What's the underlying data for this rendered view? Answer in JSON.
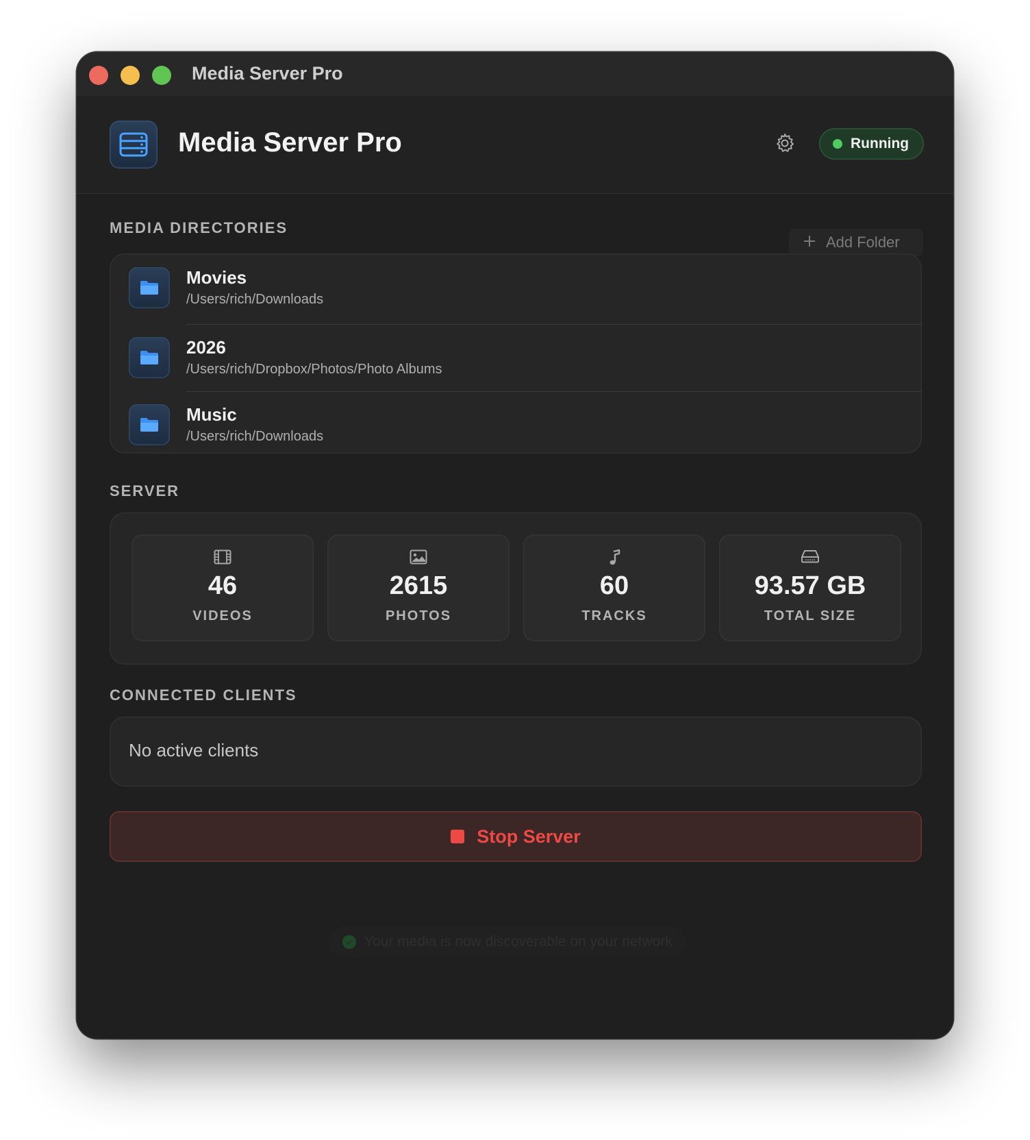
{
  "window": {
    "title": "Media Server Pro"
  },
  "header": {
    "app_name": "Media Server Pro",
    "app_icon": "server-rack-icon",
    "settings_icon": "gear-icon",
    "status": "Running",
    "status_color": "#4fcb62"
  },
  "directories": {
    "label": "MEDIA DIRECTORIES",
    "add_button": "Add Folder",
    "items": [
      {
        "name": "Movies",
        "path": "/Users/rich/Downloads",
        "icon": "folder-icon"
      },
      {
        "name": "2026",
        "path": "/Users/rich/Dropbox/Photos/Photo Albums",
        "icon": "folder-icon"
      },
      {
        "name": "Music",
        "path": "/Users/rich/Downloads",
        "icon": "folder-icon"
      }
    ]
  },
  "server": {
    "label": "SERVER",
    "stats": [
      {
        "value": "46",
        "label": "VIDEOS",
        "icon": "film-icon"
      },
      {
        "value": "2615",
        "label": "PHOTOS",
        "icon": "photo-icon"
      },
      {
        "value": "60",
        "label": "TRACKS",
        "icon": "music-note-icon"
      },
      {
        "value": "93.57 GB",
        "label": "TOTAL SIZE",
        "icon": "drive-icon"
      }
    ]
  },
  "clients": {
    "label": "CONNECTED CLIENTS",
    "empty_text": "No active clients"
  },
  "actions": {
    "stop_label": "Stop Server",
    "stop_color": "#ee4a45"
  },
  "toast": {
    "text": "Your media is now discoverable on your network",
    "icon": "checkmark-circle-icon"
  }
}
